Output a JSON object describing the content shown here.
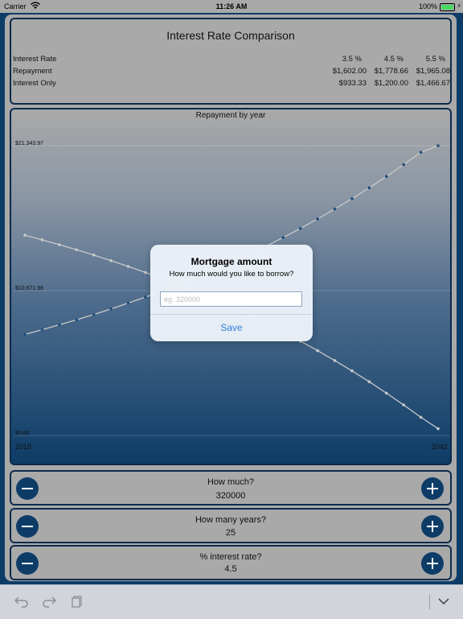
{
  "status_bar": {
    "carrier": "Carrier",
    "time": "11:26 AM",
    "battery": "100%"
  },
  "header": {
    "title": "Interest Rate Comparison",
    "columns": [
      "3.5 %",
      "4.5 %",
      "5.5 %"
    ],
    "rows": [
      {
        "label": "Interest Rate",
        "values": [
          "3.5 %",
          "4.5 %",
          "5.5 %"
        ]
      },
      {
        "label": "Repayment",
        "values": [
          "$1,602.00",
          "$1,778.66",
          "$1,965.08"
        ]
      },
      {
        "label": "Interest Only",
        "values": [
          "$933.33",
          "$1,200.00",
          "$1,466.67"
        ]
      }
    ]
  },
  "chart_data": {
    "type": "line",
    "title": "Repayment by year",
    "x_start_label": "2018",
    "x_end_label": "2042",
    "y_tick_labels": [
      "$21,343.97",
      "$10,671.98",
      "$0.00"
    ],
    "ylim": [
      0,
      21343.97
    ],
    "x": [
      2018,
      2019,
      2020,
      2021,
      2022,
      2023,
      2024,
      2025,
      2026,
      2027,
      2028,
      2029,
      2030,
      2031,
      2032,
      2033,
      2034,
      2035,
      2036,
      2037,
      2038,
      2039,
      2040,
      2041,
      2042
    ],
    "series": [
      {
        "color": "#1f4e7a",
        "values": [
          7450,
          7790,
          8150,
          8520,
          8910,
          9320,
          9750,
          10190,
          10660,
          11150,
          11660,
          12190,
          12750,
          13330,
          13940,
          14580,
          15250,
          15950,
          16680,
          17440,
          18240,
          19080,
          19950,
          20860,
          21343.97
        ]
      },
      {
        "color": "#c9c9c9",
        "values": [
          14750,
          14410,
          14050,
          13680,
          13290,
          12880,
          12450,
          12010,
          11540,
          11050,
          10540,
          10010,
          9450,
          8870,
          8260,
          7620,
          6950,
          6250,
          5520,
          4760,
          3960,
          3120,
          2250,
          1340,
          500
        ]
      }
    ]
  },
  "controls": [
    {
      "question": "How much?",
      "value": "320000"
    },
    {
      "question": "How many years?",
      "value": "25"
    },
    {
      "question": "% interest rate?",
      "value": "4.5"
    }
  ],
  "dialog": {
    "title": "Mortgage amount",
    "message": "How much would you like to borrow?",
    "placeholder": "eg. 320000",
    "save_label": "Save"
  },
  "icons": {
    "undo": "undo-icon",
    "redo": "redo-icon",
    "paste": "clipboard-icon",
    "collapse": "chevron-down-icon"
  },
  "colors": {
    "accent": "#0d3c67",
    "link": "#2d7ed8",
    "panel": "#a9a9a9"
  }
}
